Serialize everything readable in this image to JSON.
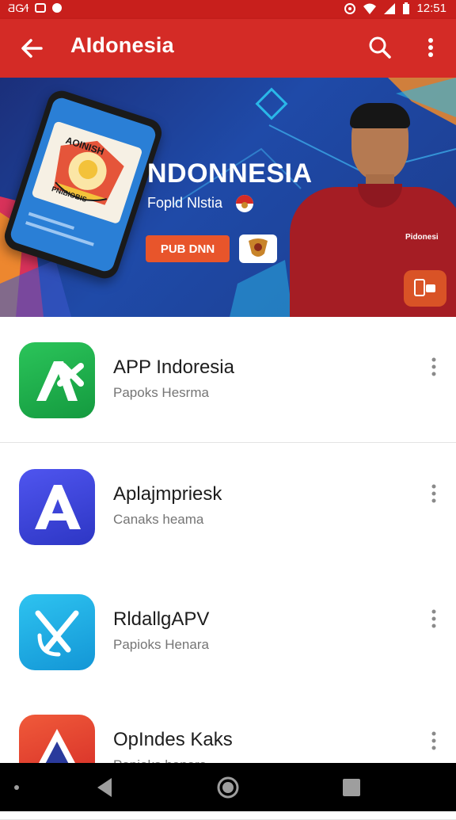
{
  "status_bar": {
    "left_text": "ƋG⁄Ɨ",
    "time": "12:51"
  },
  "app_bar": {
    "title": "AIdonesia"
  },
  "banner": {
    "title": "NDONNESIA",
    "subtitle": "Fopld Nlstia",
    "button_label": "PUB DNN",
    "phone_text": "AOINISH",
    "phone_subtext": "PNIBIOBIS",
    "shirt_text": "Pidonesi",
    "colors": {
      "bg": "#1f4aa8",
      "button": "#e8552b",
      "shirt": "#a51d24"
    }
  },
  "apps": [
    {
      "name": "APP Indoresia",
      "subtitle": "Papoks Hesrma",
      "icon": "a-star-icon",
      "color": "#1faa4a"
    },
    {
      "name": "Aplajmpriesk",
      "subtitle": "Canaks heama",
      "icon": "a-letter-icon",
      "color": "#3b42d9"
    },
    {
      "name": "RldallgAPV",
      "subtitle": "Papioks Henara",
      "icon": "k-letter-icon",
      "color": "#19a9e3"
    },
    {
      "name": "OpIndes Kaks",
      "subtitle": "Papioks henara",
      "icon": "a-triangle-icon",
      "color": "#e43b2c"
    }
  ],
  "nav": {
    "icons": [
      "back-icon",
      "home-icon",
      "recents-icon"
    ]
  }
}
